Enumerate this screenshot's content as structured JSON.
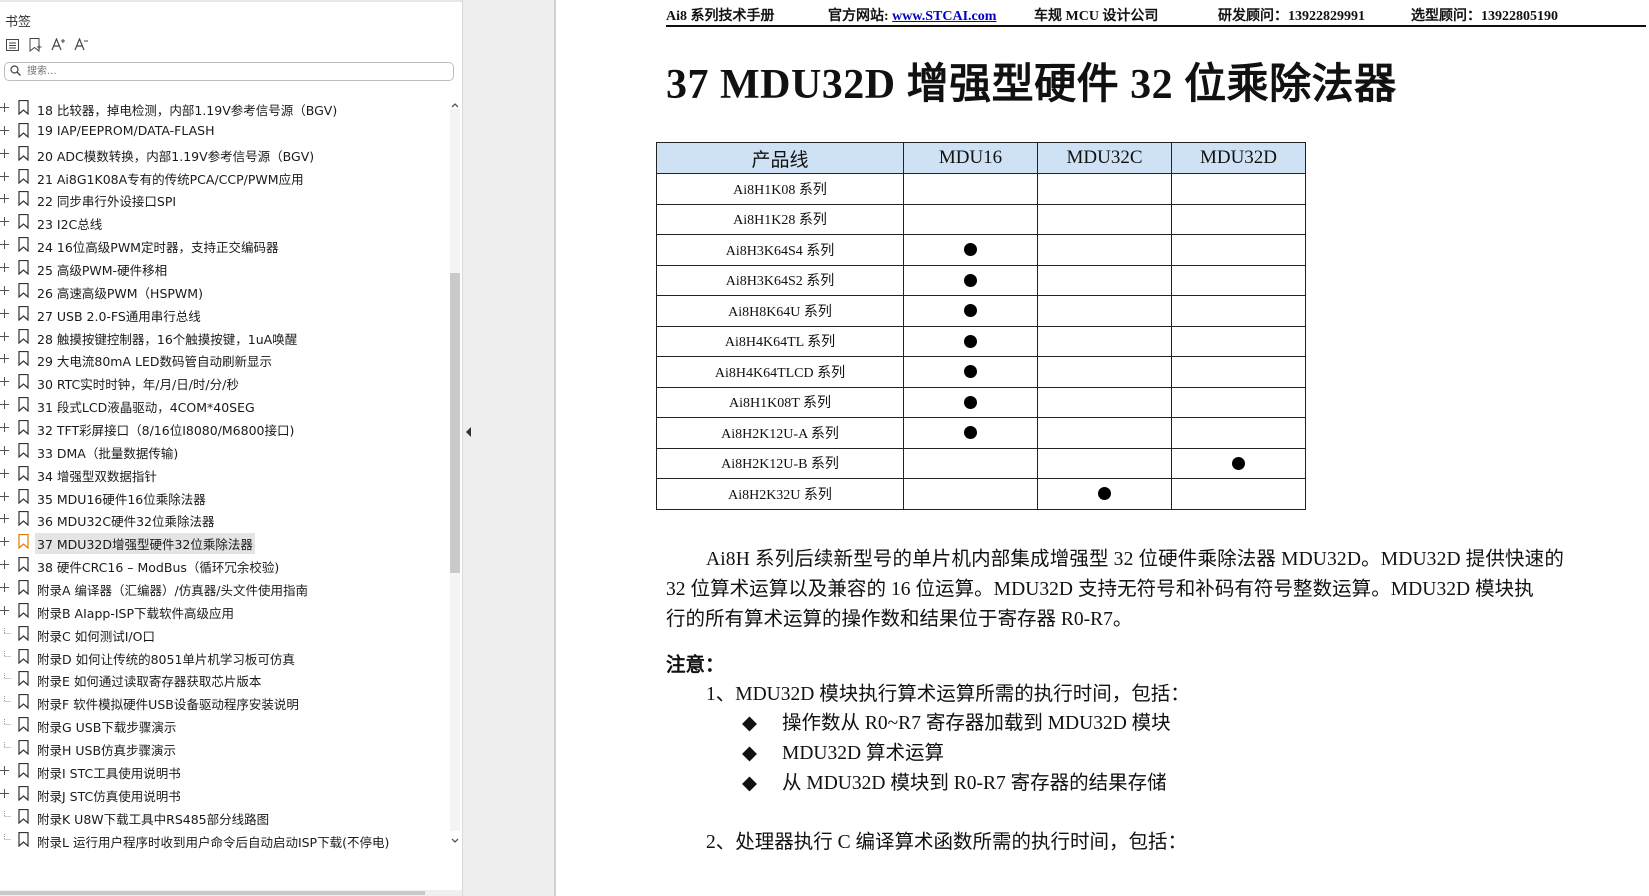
{
  "sidebar": {
    "title": "书签",
    "search": {
      "placeholder": "搜索..."
    },
    "bookmarks": [
      {
        "label": "18  比较器，掉电检测，内部1.19V参考信号源（BGV)",
        "expandable": true
      },
      {
        "label": "19  IAP/EEPROM/DATA-FLASH",
        "expandable": true
      },
      {
        "label": "20  ADC模数转换，内部1.19V参考信号源（BGV)",
        "expandable": true
      },
      {
        "label": "21  Ai8G1K08A专有的传统PCA/CCP/PWM应用",
        "expandable": true
      },
      {
        "label": "22  同步串行外设接口SPI",
        "expandable": true
      },
      {
        "label": "23  I2C总线",
        "expandable": true
      },
      {
        "label": "24  16位高级PWM定时器，支持正交编码器",
        "expandable": true
      },
      {
        "label": "25  高级PWM-硬件移相",
        "expandable": true
      },
      {
        "label": "26  高速高级PWM（HSPWM)",
        "expandable": true
      },
      {
        "label": "27  USB 2.0-FS通用串行总线",
        "expandable": true
      },
      {
        "label": "28  触摸按键控制器，16个触摸按键，1uA唤醒",
        "expandable": true
      },
      {
        "label": "29  大电流80mA  LED数码管自动刷新显示",
        "expandable": true
      },
      {
        "label": "30  RTC实时时钟，年/月/日/时/分/秒",
        "expandable": true
      },
      {
        "label": "31  段式LCD液晶驱动，4COM*40SEG",
        "expandable": true
      },
      {
        "label": "32  TFT彩屏接口（8/16位I8080/M6800接口)",
        "expandable": true
      },
      {
        "label": "33  DMA（批量数据传输)",
        "expandable": true
      },
      {
        "label": "34  增强型双数据指针",
        "expandable": true
      },
      {
        "label": "35  MDU16硬件16位乘除法器",
        "expandable": true
      },
      {
        "label": "36  MDU32C硬件32位乘除法器",
        "expandable": true
      },
      {
        "label": "37  MDU32D增强型硬件32位乘除法器",
        "expandable": true,
        "selected": true
      },
      {
        "label": "38  硬件CRC16 – ModBus（循环冗余校验)",
        "expandable": true
      },
      {
        "label": "附录A  编译器（汇编器）/仿真器/头文件使用指南",
        "expandable": true
      },
      {
        "label": "附录B  AIapp-ISP下载软件高级应用",
        "expandable": true
      },
      {
        "label": "附录C  如何测试I/O口",
        "expandable": false
      },
      {
        "label": "附录D  如何让传统的8051单片机学习板可仿真",
        "expandable": false
      },
      {
        "label": "附录E  如何通过读取寄存器获取芯片版本",
        "expandable": false
      },
      {
        "label": "附录F  软件模拟硬件USB设备驱动程序安装说明",
        "expandable": false
      },
      {
        "label": "附录G  USB下载步骤演示",
        "expandable": false
      },
      {
        "label": "附录H  USB仿真步骤演示",
        "expandable": false
      },
      {
        "label": "附录I  STC工具使用说明书",
        "expandable": true
      },
      {
        "label": "附录J  STC仿真使用说明书",
        "expandable": true
      },
      {
        "label": "附录K  U8W下载工具中RS485部分线路图",
        "expandable": false
      },
      {
        "label": "附录L  运行用户程序时收到用户命令后自动启动ISP下载(不停电)",
        "expandable": false
      }
    ]
  },
  "document": {
    "header": {
      "manual": "Ai8 系列技术手册",
      "site_label": "官方网站: ",
      "site_link": "www.STCAI.com",
      "company": "车规 MCU 设计公司",
      "rd_advisor": "研发顾问：13922829991",
      "selection_advisor": "选型顾问：13922805190"
    },
    "title": "37  MDU32D 增强型硬件 32 位乘除法器",
    "table": {
      "headers": [
        "产品线",
        "MDU16",
        "MDU32C",
        "MDU32D"
      ],
      "rows": [
        {
          "name": "Ai8H1K08 系列",
          "marks": [
            false,
            false,
            false
          ]
        },
        {
          "name": "Ai8H1K28 系列",
          "marks": [
            false,
            false,
            false
          ]
        },
        {
          "name": "Ai8H3K64S4 系列",
          "marks": [
            true,
            false,
            false
          ]
        },
        {
          "name": "Ai8H3K64S2 系列",
          "marks": [
            true,
            false,
            false
          ]
        },
        {
          "name": "Ai8H8K64U 系列",
          "marks": [
            true,
            false,
            false
          ]
        },
        {
          "name": "Ai8H4K64TL 系列",
          "marks": [
            true,
            false,
            false
          ]
        },
        {
          "name": "Ai8H4K64TLCD 系列",
          "marks": [
            true,
            false,
            false
          ]
        },
        {
          "name": "Ai8H1K08T 系列",
          "marks": [
            true,
            false,
            false
          ]
        },
        {
          "name": "Ai8H2K12U-A 系列",
          "marks": [
            true,
            false,
            false
          ]
        },
        {
          "name": "Ai8H2K12U-B 系列",
          "marks": [
            false,
            false,
            true
          ]
        },
        {
          "name": "Ai8H2K32U 系列",
          "marks": [
            false,
            true,
            false
          ]
        }
      ]
    },
    "intro_line1": "Ai8H 系列后续新型号的单片机内部集成增强型 32 位硬件乘除法器 MDU32D。MDU32D 提供快速的",
    "intro_line2": "32 位算术运算以及兼容的 16 位运算。MDU32D 支持无符号和补码有符号整数运算。MDU32D 模块执",
    "intro_line3": "行的所有算术运算的操作数和结果位于寄存器 R0-R7。",
    "note_label": "注意：",
    "note_item1": "1、MDU32D 模块执行算术运算所需的执行时间，包括：",
    "bullet_symbol": "◆",
    "bullets": [
      "操作数从 R0~R7 寄存器加载到 MDU32D 模块",
      "MDU32D 算术运算",
      "从 MDU32D 模块到 R0-R7 寄存器的结果存储"
    ],
    "note_item2": "2、处理器执行 C 编译算术函数所需的执行时间，包括："
  }
}
